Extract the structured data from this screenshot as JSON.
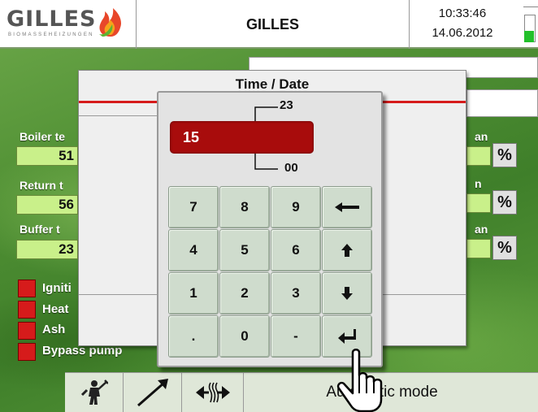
{
  "header": {
    "brand": "GILLES",
    "brand_sub": "BIOMASSEHEIZUNGEN",
    "title": "GILLES",
    "time": "10:33:46",
    "date": "14.06.2012"
  },
  "background": {
    "boiler_label": "Boiler te",
    "boiler_value": "51",
    "return_label": "Return t",
    "return_value": "56",
    "buffer_label": "Buffer t",
    "buffer_value": "23",
    "fan_labels": [
      "an",
      "n",
      "an"
    ],
    "pct_label": "%",
    "status_items": [
      "Igniti",
      "Heat",
      "Ash",
      "Bypass pump"
    ]
  },
  "dialog": {
    "title": "Time / Date"
  },
  "keypad": {
    "max": "23",
    "min": "00",
    "value": "15",
    "keys": [
      "7",
      "8",
      "9",
      "←",
      "4",
      "5",
      "6",
      "⬆",
      "1",
      "2",
      "3",
      "⬇",
      ".",
      "0",
      "-",
      "↵"
    ]
  },
  "toolbar": {
    "mode_label": "Automatic mode"
  },
  "colors": {
    "accent_red": "#d61b1b",
    "value_red": "#a80c0c",
    "value_green": "#c9f08a",
    "key_bg": "#cfdccd"
  },
  "icons": [
    "flame-logo-icon",
    "chimney-sweep-icon",
    "diagonal-arrow-icon",
    "heat-transfer-icon",
    "hand-pointer-icon"
  ]
}
